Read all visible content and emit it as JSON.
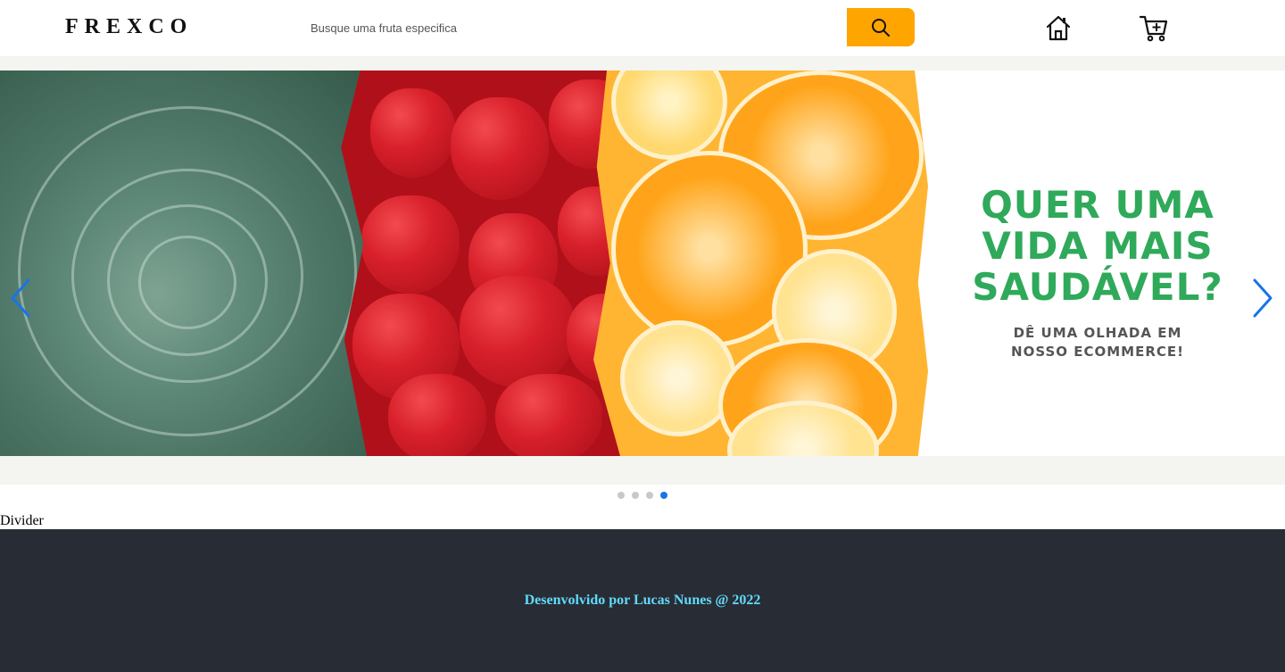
{
  "header": {
    "logo": "FREXCO",
    "search": {
      "placeholder": "Busque uma fruta especifica",
      "value": ""
    },
    "search_button_icon": "search-icon",
    "home_icon": "home-icon",
    "cart_icon": "cart-plus-icon",
    "accent_color": "#ffa500"
  },
  "banner": {
    "headline_lines": [
      "QUER UMA",
      "VIDA MAIS",
      "SAUDÁVEL?"
    ],
    "subline_lines": [
      "DÊ UMA OLHADA EM",
      "NOSSO ECOMMERCE!"
    ],
    "headline_color": "#2fa95a",
    "prev_icon": "chevron-left-icon",
    "next_icon": "chevron-right-icon",
    "slide_count": 4,
    "active_slide": 4,
    "indicator_color": "#1a73e8"
  },
  "divider": {
    "text": "Divider"
  },
  "footer": {
    "text": "Desenvolvido por Lucas Nunes @ 2022",
    "background": "#282c34",
    "text_color": "#61dafb"
  }
}
